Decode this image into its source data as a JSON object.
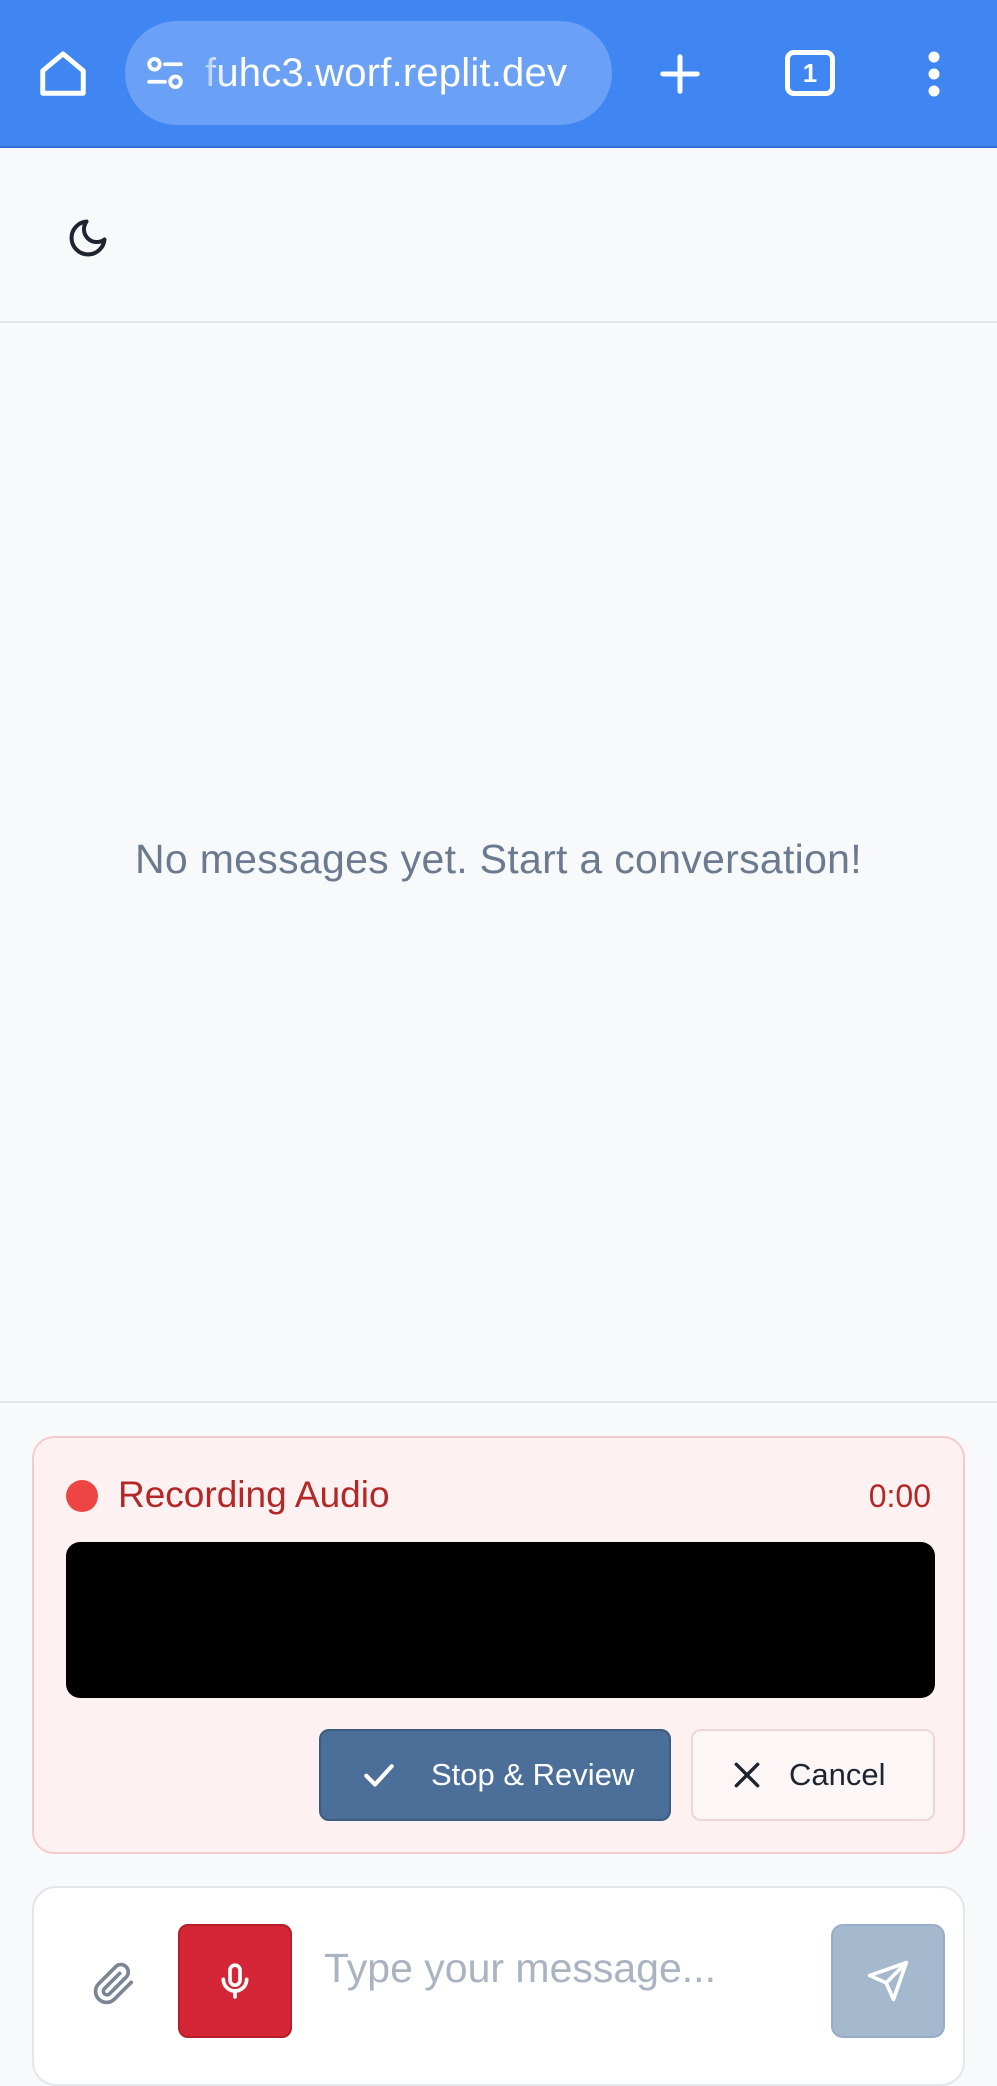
{
  "browser": {
    "url": "fuhc3.worf.replit.dev",
    "tab_count": "1",
    "icons": [
      "home-icon",
      "site-settings-icon",
      "new-tab-icon",
      "tab-switcher-icon",
      "more-menu-icon"
    ]
  },
  "header": {
    "theme_toggle_icon": "moon-icon"
  },
  "messages": {
    "empty_text": "No messages yet. Start a conversation!"
  },
  "recording": {
    "title": "Recording Audio",
    "timer": "0:00",
    "stop_label": "Stop & Review",
    "cancel_label": "Cancel"
  },
  "composer": {
    "placeholder": "Type your message...",
    "icons": [
      "paperclip-icon",
      "microphone-icon",
      "send-icon"
    ]
  },
  "colors": {
    "browser_bar": "#3f86f2",
    "recording_accent": "#ef4444",
    "mic_button": "#d42636",
    "stop_button": "#4b6f98",
    "send_button_disabled": "#a4b8ce"
  }
}
